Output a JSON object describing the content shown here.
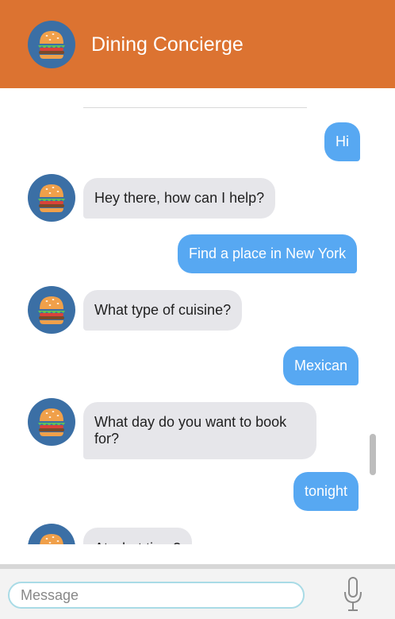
{
  "header": {
    "title": "Dining Concierge",
    "avatar_icon": "burger-icon",
    "background": "#dc7331"
  },
  "messages": [
    {
      "sender": "user",
      "text": "Hi"
    },
    {
      "sender": "bot",
      "text": "Hey there, how can I help?"
    },
    {
      "sender": "user",
      "text": "Find a place in New York"
    },
    {
      "sender": "bot",
      "text": "What type of cuisine?"
    },
    {
      "sender": "user",
      "text": "Mexican"
    },
    {
      "sender": "bot",
      "text": "What day do you want to book for?"
    },
    {
      "sender": "user",
      "text": "tonight"
    },
    {
      "sender": "bot",
      "text": "At what time?"
    }
  ],
  "composer": {
    "placeholder": "Message",
    "mic_icon": "microphone-icon"
  },
  "colors": {
    "user_bubble": "#57a8f2",
    "bot_bubble": "#e6e6ea",
    "input_border": "#a9dbe6"
  }
}
